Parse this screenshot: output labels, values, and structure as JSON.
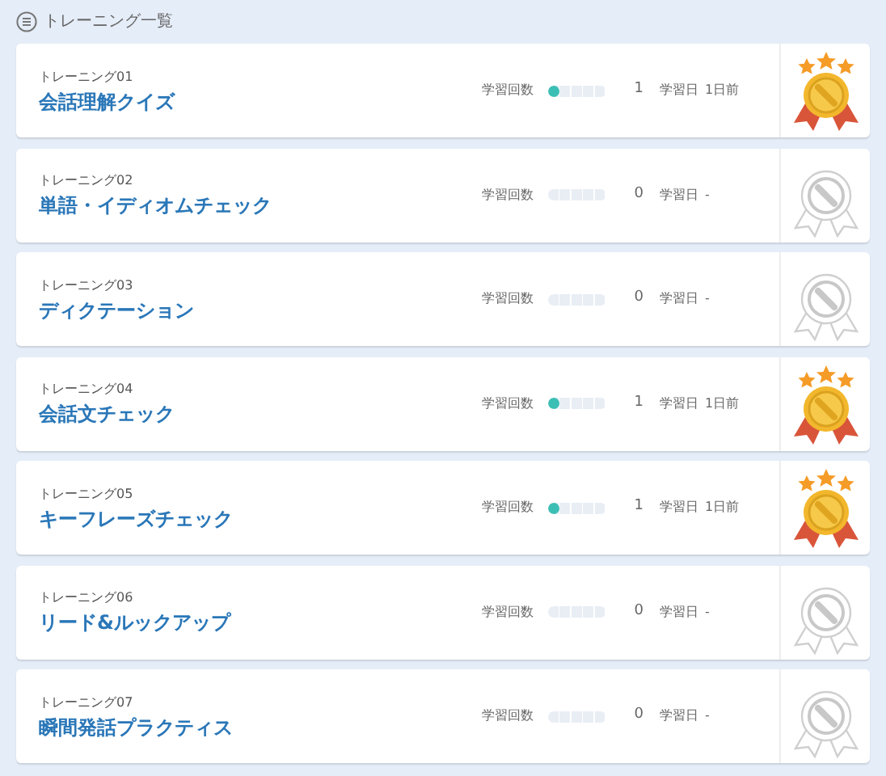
{
  "header": {
    "title": "トレーニング一覧"
  },
  "trainings": [
    {
      "number": "トレーニング01",
      "title": "会話理解クイズ",
      "count_label": "学習回数",
      "level": 0.2,
      "count": "1",
      "date_label": "学習日",
      "date": "1日前",
      "earned": true
    },
    {
      "number": "トレーニング02",
      "title": "単語・イディオムチェック",
      "count_label": "学習回数",
      "count": "0",
      "date_label": "学習日",
      "date": "-",
      "earned": false
    },
    {
      "number": "トレーニング03",
      "title": "ディクテーション",
      "count_label": "学習回数",
      "count": "0",
      "date_label": "学習日",
      "date": "-",
      "earned": false
    },
    {
      "number": "トレーニング04",
      "title": "会話文チェック",
      "count_label": "学習回数",
      "level": 0.2,
      "count": "1",
      "date_label": "学習日",
      "date": "1日前",
      "earned": true
    },
    {
      "number": "トレーニング05",
      "title": "キーフレーズチェック",
      "count_label": "学習回数",
      "level": 0.2,
      "count": "1",
      "date_label": "学習日",
      "date": "1日前",
      "earned": true
    },
    {
      "number": "トレーニング06",
      "title": "リード&ルックアップ",
      "count_label": "学習回数",
      "count": "0",
      "date_label": "学習日",
      "date": "-",
      "earned": false
    },
    {
      "number": "トレーニング07",
      "title": "瞬間発話プラクティス",
      "count_label": "学習回数",
      "count": "0",
      "date_label": "学習日",
      "date": "-",
      "earned": false
    }
  ]
}
